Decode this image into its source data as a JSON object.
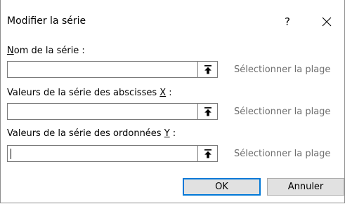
{
  "dialog": {
    "title": "Modifier la série",
    "help_label": "?",
    "close_icon": "close-icon"
  },
  "fields": {
    "series_name": {
      "label_prefix": "",
      "label_accel": "N",
      "label_rest": "om de la série :",
      "value": "",
      "range_label": "Sélectionner la plage",
      "button_icon": "collapse-range-icon"
    },
    "x_values": {
      "label_prefix": "Valeurs de la série des abscisses ",
      "label_accel": "X",
      "label_rest": " :",
      "value": "",
      "range_label": "Sélectionner la plage",
      "button_icon": "collapse-range-icon"
    },
    "y_values": {
      "label_prefix": "Valeurs de la série des ordonnées ",
      "label_accel": "Y",
      "label_rest": " :",
      "value": "",
      "range_label": "Sélectionner la plage",
      "button_icon": "collapse-range-icon"
    }
  },
  "buttons": {
    "ok_label": "OK",
    "cancel_label": "Annuler"
  },
  "colors": {
    "accent": "#0078d7",
    "button_face": "#e1e1e1",
    "hint_text": "#6d6d6d",
    "border": "#7a7a7a"
  }
}
